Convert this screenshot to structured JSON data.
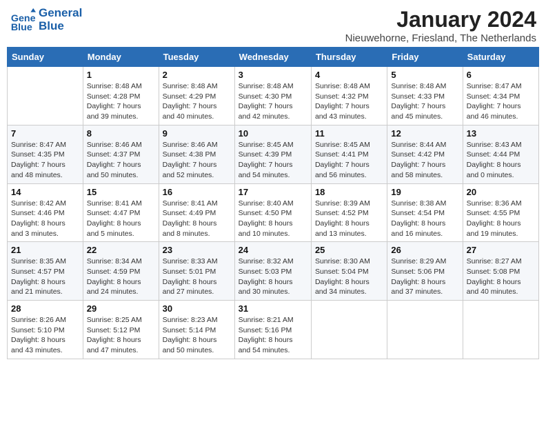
{
  "header": {
    "logo_general": "General",
    "logo_blue": "Blue",
    "title": "January 2024",
    "subtitle": "Nieuwehorne, Friesland, The Netherlands"
  },
  "days_of_week": [
    "Sunday",
    "Monday",
    "Tuesday",
    "Wednesday",
    "Thursday",
    "Friday",
    "Saturday"
  ],
  "weeks": [
    [
      {
        "day": "",
        "info": ""
      },
      {
        "day": "1",
        "info": "Sunrise: 8:48 AM\nSunset: 4:28 PM\nDaylight: 7 hours\nand 39 minutes."
      },
      {
        "day": "2",
        "info": "Sunrise: 8:48 AM\nSunset: 4:29 PM\nDaylight: 7 hours\nand 40 minutes."
      },
      {
        "day": "3",
        "info": "Sunrise: 8:48 AM\nSunset: 4:30 PM\nDaylight: 7 hours\nand 42 minutes."
      },
      {
        "day": "4",
        "info": "Sunrise: 8:48 AM\nSunset: 4:32 PM\nDaylight: 7 hours\nand 43 minutes."
      },
      {
        "day": "5",
        "info": "Sunrise: 8:48 AM\nSunset: 4:33 PM\nDaylight: 7 hours\nand 45 minutes."
      },
      {
        "day": "6",
        "info": "Sunrise: 8:47 AM\nSunset: 4:34 PM\nDaylight: 7 hours\nand 46 minutes."
      }
    ],
    [
      {
        "day": "7",
        "info": "Sunrise: 8:47 AM\nSunset: 4:35 PM\nDaylight: 7 hours\nand 48 minutes."
      },
      {
        "day": "8",
        "info": "Sunrise: 8:46 AM\nSunset: 4:37 PM\nDaylight: 7 hours\nand 50 minutes."
      },
      {
        "day": "9",
        "info": "Sunrise: 8:46 AM\nSunset: 4:38 PM\nDaylight: 7 hours\nand 52 minutes."
      },
      {
        "day": "10",
        "info": "Sunrise: 8:45 AM\nSunset: 4:39 PM\nDaylight: 7 hours\nand 54 minutes."
      },
      {
        "day": "11",
        "info": "Sunrise: 8:45 AM\nSunset: 4:41 PM\nDaylight: 7 hours\nand 56 minutes."
      },
      {
        "day": "12",
        "info": "Sunrise: 8:44 AM\nSunset: 4:42 PM\nDaylight: 7 hours\nand 58 minutes."
      },
      {
        "day": "13",
        "info": "Sunrise: 8:43 AM\nSunset: 4:44 PM\nDaylight: 8 hours\nand 0 minutes."
      }
    ],
    [
      {
        "day": "14",
        "info": "Sunrise: 8:42 AM\nSunset: 4:46 PM\nDaylight: 8 hours\nand 3 minutes."
      },
      {
        "day": "15",
        "info": "Sunrise: 8:41 AM\nSunset: 4:47 PM\nDaylight: 8 hours\nand 5 minutes."
      },
      {
        "day": "16",
        "info": "Sunrise: 8:41 AM\nSunset: 4:49 PM\nDaylight: 8 hours\nand 8 minutes."
      },
      {
        "day": "17",
        "info": "Sunrise: 8:40 AM\nSunset: 4:50 PM\nDaylight: 8 hours\nand 10 minutes."
      },
      {
        "day": "18",
        "info": "Sunrise: 8:39 AM\nSunset: 4:52 PM\nDaylight: 8 hours\nand 13 minutes."
      },
      {
        "day": "19",
        "info": "Sunrise: 8:38 AM\nSunset: 4:54 PM\nDaylight: 8 hours\nand 16 minutes."
      },
      {
        "day": "20",
        "info": "Sunrise: 8:36 AM\nSunset: 4:55 PM\nDaylight: 8 hours\nand 19 minutes."
      }
    ],
    [
      {
        "day": "21",
        "info": "Sunrise: 8:35 AM\nSunset: 4:57 PM\nDaylight: 8 hours\nand 21 minutes."
      },
      {
        "day": "22",
        "info": "Sunrise: 8:34 AM\nSunset: 4:59 PM\nDaylight: 8 hours\nand 24 minutes."
      },
      {
        "day": "23",
        "info": "Sunrise: 8:33 AM\nSunset: 5:01 PM\nDaylight: 8 hours\nand 27 minutes."
      },
      {
        "day": "24",
        "info": "Sunrise: 8:32 AM\nSunset: 5:03 PM\nDaylight: 8 hours\nand 30 minutes."
      },
      {
        "day": "25",
        "info": "Sunrise: 8:30 AM\nSunset: 5:04 PM\nDaylight: 8 hours\nand 34 minutes."
      },
      {
        "day": "26",
        "info": "Sunrise: 8:29 AM\nSunset: 5:06 PM\nDaylight: 8 hours\nand 37 minutes."
      },
      {
        "day": "27",
        "info": "Sunrise: 8:27 AM\nSunset: 5:08 PM\nDaylight: 8 hours\nand 40 minutes."
      }
    ],
    [
      {
        "day": "28",
        "info": "Sunrise: 8:26 AM\nSunset: 5:10 PM\nDaylight: 8 hours\nand 43 minutes."
      },
      {
        "day": "29",
        "info": "Sunrise: 8:25 AM\nSunset: 5:12 PM\nDaylight: 8 hours\nand 47 minutes."
      },
      {
        "day": "30",
        "info": "Sunrise: 8:23 AM\nSunset: 5:14 PM\nDaylight: 8 hours\nand 50 minutes."
      },
      {
        "day": "31",
        "info": "Sunrise: 8:21 AM\nSunset: 5:16 PM\nDaylight: 8 hours\nand 54 minutes."
      },
      {
        "day": "",
        "info": ""
      },
      {
        "day": "",
        "info": ""
      },
      {
        "day": "",
        "info": ""
      }
    ]
  ]
}
